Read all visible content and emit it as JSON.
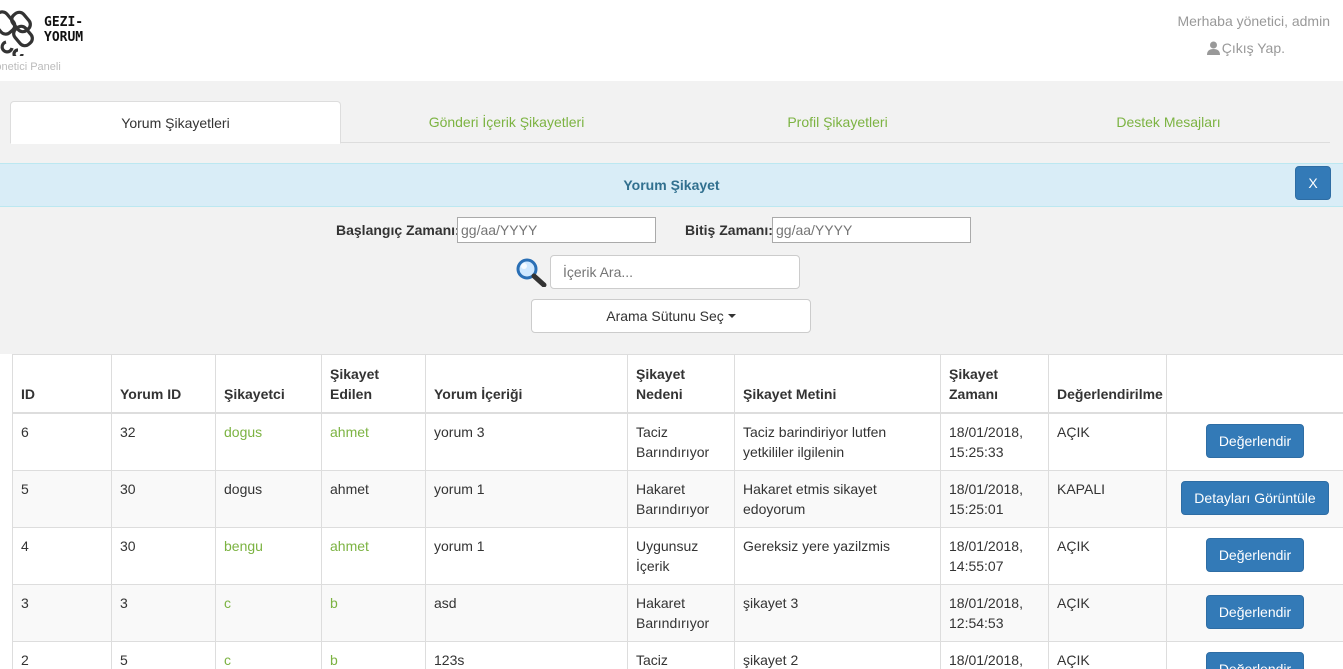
{
  "header": {
    "logo_text_1": "GEZI-",
    "logo_text_2": "YORUM",
    "subtitle": "Yönetici Paneli",
    "greeting": "Merhaba yönetici, admin",
    "logout": "Çıkış Yap."
  },
  "tabs": [
    {
      "label": "Yorum Şikayetleri",
      "active": true
    },
    {
      "label": "Gönderi İçerik Şikayetleri",
      "active": false
    },
    {
      "label": "Profil Şikayetleri",
      "active": false
    },
    {
      "label": "Destek Mesajları",
      "active": false
    }
  ],
  "panel": {
    "title": "Yorum Şikayet",
    "close_label": "X"
  },
  "filters": {
    "start_label": "Başlangıç Zamanı:",
    "start_placeholder": "gg/aa/YYYY",
    "end_label": "Bitiş Zamanı:",
    "end_placeholder": "gg/aa/YYYY",
    "search_placeholder": "İçerik Ara...",
    "column_select_label": "Arama Sütunu Seç"
  },
  "table": {
    "headers": [
      "ID",
      "Yorum ID",
      "Şikayetci",
      "Şikayet Edilen",
      "Yorum İçeriği",
      "Şikayet Nedeni",
      "Şikayet Metini",
      "Şikayet Zamanı",
      "Değerlendirilme",
      ""
    ],
    "rows": [
      {
        "id": "6",
        "yorum_id": "32",
        "sikayetci": "dogus",
        "edilen": "ahmet",
        "icerik": "yorum 3",
        "neden": "Taciz Barındırıyor",
        "metin": "Taciz barindiriyor lutfen yetkililer ilgilenin",
        "zaman": "18/01/2018, 15:25:33",
        "durum": "AÇIK",
        "action": "Değerlendir",
        "linked": true
      },
      {
        "id": "5",
        "yorum_id": "30",
        "sikayetci": "dogus",
        "edilen": "ahmet",
        "icerik": "yorum 1",
        "neden": "Hakaret Barındırıyor",
        "metin": "Hakaret etmis sikayet edoyorum",
        "zaman": "18/01/2018, 15:25:01",
        "durum": "KAPALI",
        "action": "Detayları Görüntüle",
        "linked": false
      },
      {
        "id": "4",
        "yorum_id": "30",
        "sikayetci": "bengu",
        "edilen": "ahmet",
        "icerik": "yorum 1",
        "neden": "Uygunsuz İçerik",
        "metin": "Gereksiz yere yazilzmis",
        "zaman": "18/01/2018, 14:55:07",
        "durum": "AÇIK",
        "action": "Değerlendir",
        "linked": true
      },
      {
        "id": "3",
        "yorum_id": "3",
        "sikayetci": "c",
        "edilen": "b",
        "icerik": "asd",
        "neden": "Hakaret Barındırıyor",
        "metin": "şikayet 3",
        "zaman": "18/01/2018, 12:54:53",
        "durum": "AÇIK",
        "action": "Değerlendir",
        "linked": true
      },
      {
        "id": "2",
        "yorum_id": "5",
        "sikayetci": "c",
        "edilen": "b",
        "icerik": "123s",
        "neden": "Taciz",
        "metin": "şikayet 2",
        "zaman": "18/01/2018,",
        "durum": "AÇIK",
        "action": "Değerlendir",
        "linked": true
      }
    ]
  },
  "colors": {
    "accent_green": "#7cb342",
    "primary_blue": "#337ab7",
    "panel_info": "#d9edf7"
  }
}
